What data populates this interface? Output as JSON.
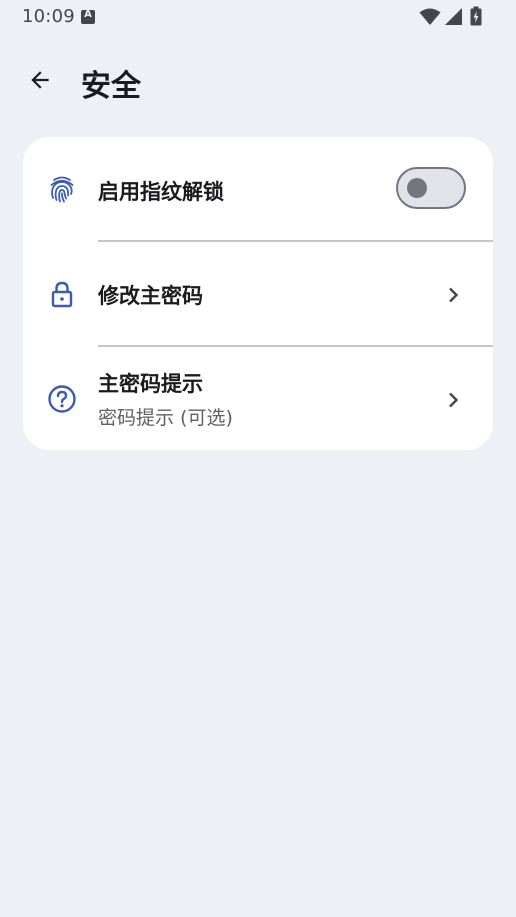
{
  "status_bar": {
    "time": "10:09",
    "icons": [
      "a-icon",
      "wifi-icon",
      "signal-icon",
      "battery-charging-icon"
    ]
  },
  "app_bar": {
    "title": "安全",
    "back_icon": "arrow-back-icon"
  },
  "settings": {
    "fingerprint_unlock": {
      "label": "启用指纹解锁",
      "icon": "fingerprint-icon",
      "enabled": false
    },
    "change_master_password": {
      "label": "修改主密码",
      "icon": "lock-icon"
    },
    "master_password_hint": {
      "label": "主密码提示",
      "subtitle": "密码提示 (可选)",
      "icon": "help-circle-icon"
    }
  },
  "colors": {
    "background": "#eff0f5",
    "card": "#ffffff",
    "accent_icon": "#3f5bab",
    "switch_off": "#74767f",
    "divider": "#c4c6cf"
  }
}
